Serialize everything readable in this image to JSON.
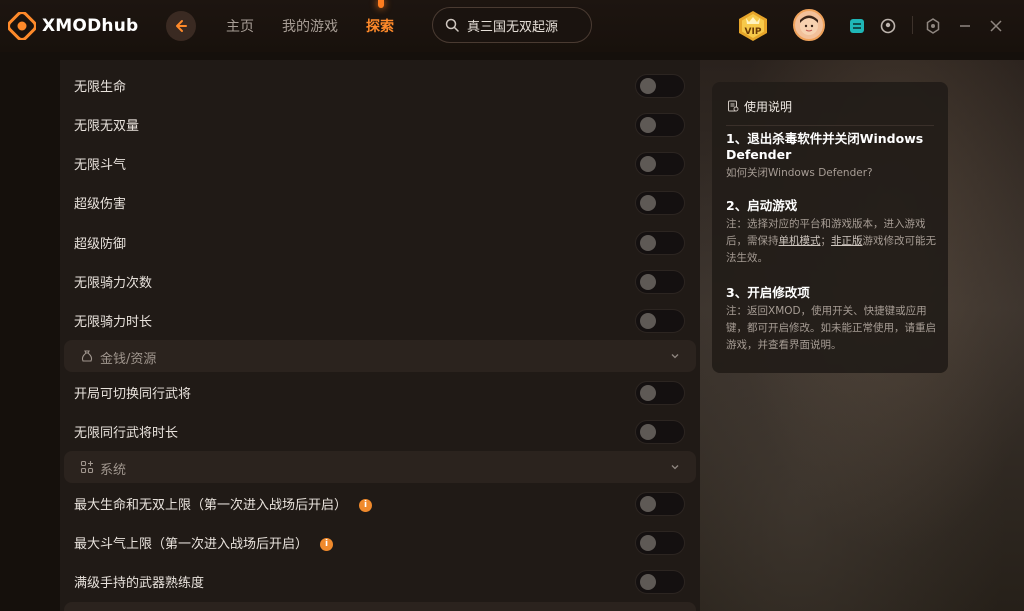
{
  "app": {
    "name": "XMODhub"
  },
  "nav": {
    "home": "主页",
    "my_games": "我的游戏",
    "explore": "探索"
  },
  "search": {
    "value": "真三国无双起源"
  },
  "badges": {
    "vip": "VIP"
  },
  "rows_a": [
    {
      "label": "无限生命",
      "on": false
    },
    {
      "label": "无限无双量",
      "on": false
    },
    {
      "label": "无限斗气",
      "on": false
    },
    {
      "label": "超级伤害",
      "on": false
    },
    {
      "label": "超级防御",
      "on": false
    },
    {
      "label": "无限骑力次数",
      "on": false
    },
    {
      "label": "无限骑力时长",
      "on": false
    }
  ],
  "section_money": {
    "label": "金钱/资源"
  },
  "rows_b": [
    {
      "label": "开局可切换同行武将",
      "on": false
    },
    {
      "label": "无限同行武将时长",
      "on": false
    }
  ],
  "section_system": {
    "label": "系统"
  },
  "rows_c": [
    {
      "label": "最大生命和无双上限（第一次进入战场后开启）",
      "info": "i",
      "on": false
    },
    {
      "label": "最大斗气上限（第一次进入战场后开启）",
      "info": "i",
      "on": false
    },
    {
      "label": "满级手持的武器熟练度",
      "on": false
    }
  ],
  "guide": {
    "title": "使用说明",
    "step1_title": "1、退出杀毒软件并关闭Windows Defender",
    "step1_text": "如何关闭Windows Defender?",
    "step2_title": "2、启动游戏",
    "step2_text_a": "注：选择对应的平台和游戏版本，进入游戏后，需保持",
    "step2_link1": "单机模式",
    "step2_text_b": "；",
    "step2_link2": "非正版",
    "step2_text_c": "游戏修改可能无法生效。",
    "step3_title": "3、开启修改项",
    "step3_text": "注：返回XMOD，使用开关、快捷键或应用键，都可开启修改。如未能正常使用，请重启游戏，并查看界面说明。"
  },
  "colors": {
    "accent": "#ff8a2a",
    "background": "#15100c",
    "panel": "#201a16"
  }
}
